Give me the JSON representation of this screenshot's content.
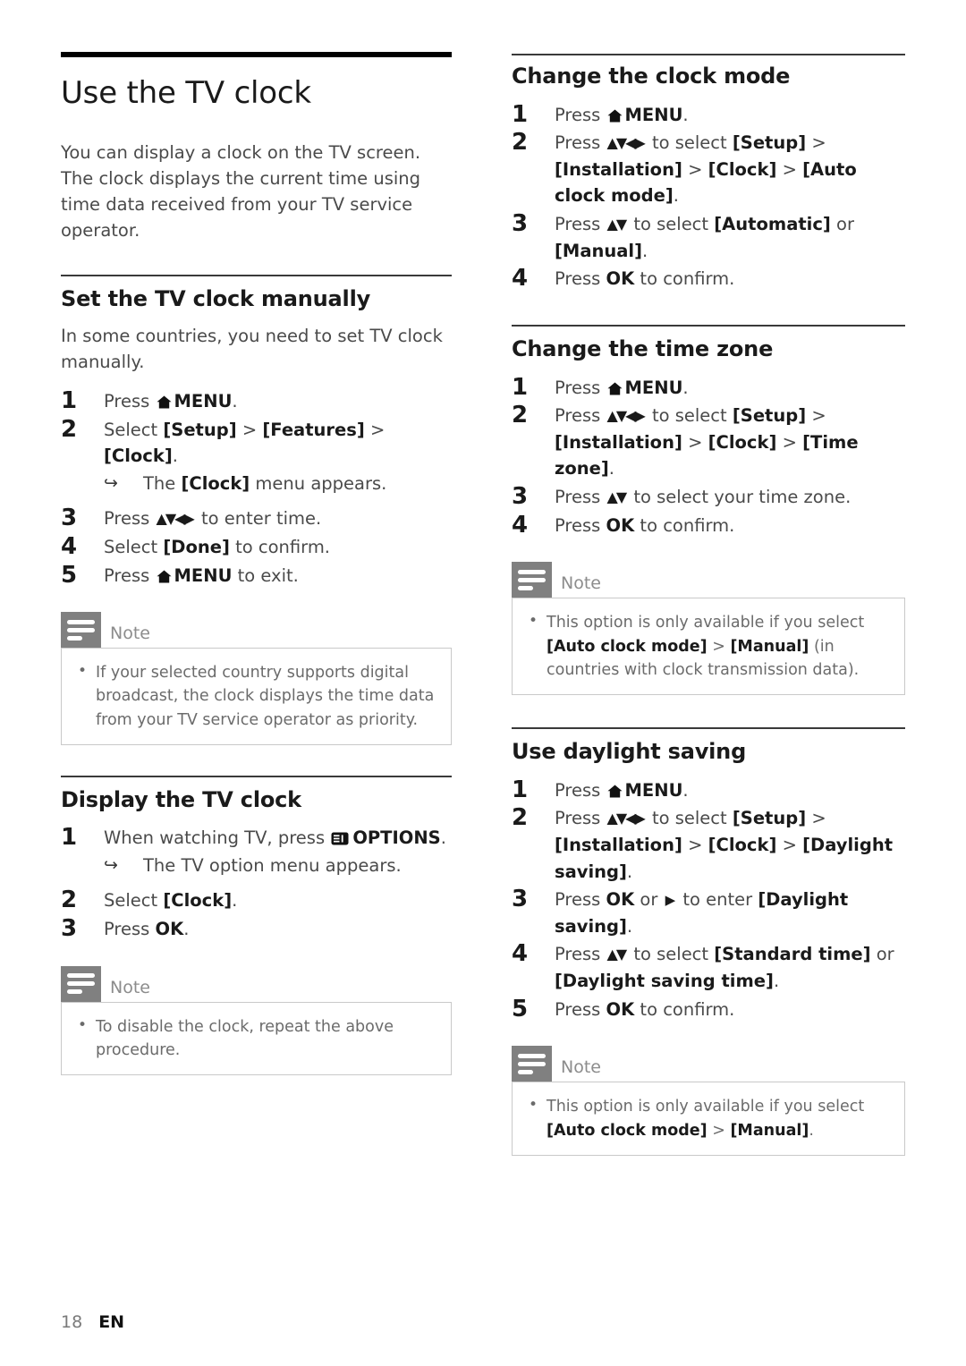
{
  "page": {
    "number": "18",
    "language": "EN"
  },
  "icons": {
    "home": "home-icon",
    "options": "options-icon",
    "updown": "▲▼",
    "updownleftright": "▲▼◀▶",
    "right": "▶",
    "hook": "↪",
    "note": "note-icon"
  },
  "left_column": {
    "title": "Use the TV clock",
    "intro": "You can display a clock on the TV screen. The clock displays the current time using time data received from your TV service operator.",
    "sections": [
      {
        "heading": "Set the TV clock manually",
        "intro": "In some countries, you need to set TV clock manually.",
        "steps": [
          {
            "num": "1",
            "pre": "Press ",
            "icon": "home",
            "strong1": "MENU",
            "post": "."
          },
          {
            "num": "2",
            "pre": "Select ",
            "strong1": "[Setup]",
            "sep1": " > ",
            "strong2": "[Features]",
            "sep2": " > ",
            "strong3": "[Clock]",
            "post": ".",
            "subnote_pre": "The ",
            "subnote_strong": "[Clock]",
            "subnote_post": " menu appears."
          },
          {
            "num": "3",
            "pre": "Press ",
            "arrows": "▲▼◀▶",
            "post": " to enter time."
          },
          {
            "num": "4",
            "pre": "Select ",
            "strong1": "[Done]",
            "post": " to confirm."
          },
          {
            "num": "5",
            "pre": "Press ",
            "icon": "home",
            "strong1": "MENU",
            "post": " to exit."
          }
        ],
        "note": {
          "label": "Note",
          "items": [
            {
              "pre": "If your selected country supports digital broadcast, the clock displays the time data from your TV service operator as priority."
            }
          ]
        }
      },
      {
        "heading": "Display the TV clock",
        "steps": [
          {
            "num": "1",
            "pre": "When watching TV, press ",
            "icon": "options",
            "strong1": "OPTIONS",
            "post": ".",
            "subnote_pre": "The TV option menu appears."
          },
          {
            "num": "2",
            "pre": "Select ",
            "strong1": "[Clock]",
            "post": "."
          },
          {
            "num": "3",
            "pre": "Press ",
            "strong1": "OK",
            "post": "."
          }
        ],
        "note": {
          "label": "Note",
          "items": [
            {
              "pre": "To disable the clock, repeat the above procedure."
            }
          ]
        }
      }
    ]
  },
  "right_column": {
    "sections": [
      {
        "heading": "Change the clock mode",
        "steps": [
          {
            "num": "1",
            "pre": "Press ",
            "icon": "home",
            "strong1": "MENU",
            "post": "."
          },
          {
            "num": "2",
            "pre": "Press ",
            "arrows": "▲▼◀▶",
            "mid": " to select ",
            "strong1": "[Setup]",
            "sep1": " > ",
            "strong2": "[Installation]",
            "sep2": " > ",
            "strong3": "[Clock]",
            "sep3": " > ",
            "strong4": "[Auto clock mode]",
            "post": "."
          },
          {
            "num": "3",
            "pre": "Press ",
            "arrows": "▲▼",
            "mid": " to select ",
            "strong1": "[Automatic]",
            "sep1": " or ",
            "strong2": "[Manual]",
            "post": "."
          },
          {
            "num": "4",
            "pre": "Press ",
            "strong1": "OK",
            "post": " to confirm."
          }
        ]
      },
      {
        "heading": "Change the time zone",
        "steps": [
          {
            "num": "1",
            "pre": "Press ",
            "icon": "home",
            "strong1": "MENU",
            "post": "."
          },
          {
            "num": "2",
            "pre": "Press ",
            "arrows": "▲▼◀▶",
            "mid": " to select ",
            "strong1": "[Setup]",
            "sep1": " > ",
            "strong2": "[Installation]",
            "sep2": " > ",
            "strong3": "[Clock]",
            "sep3": " > ",
            "strong4": "[Time zone]",
            "post": "."
          },
          {
            "num": "3",
            "pre": "Press ",
            "arrows": "▲▼",
            "mid": " to select your time zone."
          },
          {
            "num": "4",
            "pre": "Press ",
            "strong1": "OK",
            "post": " to confirm."
          }
        ],
        "note": {
          "label": "Note",
          "items": [
            {
              "pre": "This option is only available if you select ",
              "strong1": "[Auto clock mode]",
              "sep1": " > ",
              "strong2": "[Manual]",
              "post": " (in countries with clock transmission data)."
            }
          ]
        }
      },
      {
        "heading": "Use daylight saving",
        "steps": [
          {
            "num": "1",
            "pre": "Press ",
            "icon": "home",
            "strong1": "MENU",
            "post": "."
          },
          {
            "num": "2",
            "pre": "Press ",
            "arrows": "▲▼◀▶",
            "mid": " to select ",
            "strong1": "[Setup]",
            "sep1": " > ",
            "strong2": "[Installation]",
            "sep2": " > ",
            "strong3": "[Clock]",
            "sep3": " > ",
            "strong4": "[Daylight saving]",
            "post": "."
          },
          {
            "num": "3",
            "pre": "Press ",
            "strong1": "OK",
            "sep1": " or ",
            "arrows": "▶",
            "mid": " to enter ",
            "strong2": "[Daylight saving]",
            "post": "."
          },
          {
            "num": "4",
            "pre": "Press ",
            "arrows": "▲▼",
            "mid": " to select ",
            "strong1": "[Standard time]",
            "sep1": " or ",
            "strong2": "[Daylight saving time]",
            "post": "."
          },
          {
            "num": "5",
            "pre": "Press ",
            "strong1": "OK",
            "post": " to confirm."
          }
        ],
        "note": {
          "label": "Note",
          "items": [
            {
              "pre": "This option is only available if you select ",
              "strong1": "[Auto clock mode]",
              "sep1": " > ",
              "strong2": "[Manual]",
              "post": "."
            }
          ]
        }
      }
    ]
  }
}
